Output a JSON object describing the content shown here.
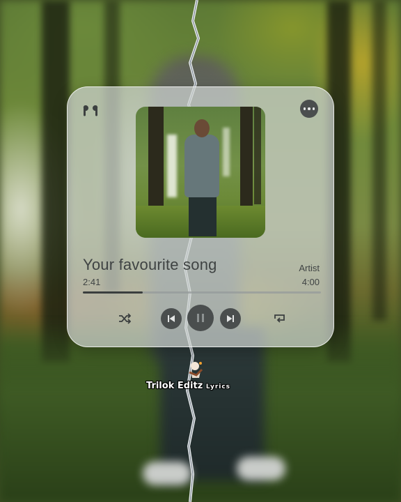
{
  "player": {
    "song_title": "Your favourite song",
    "artist": "Artist",
    "current_time": "2:41",
    "total_time": "4:00",
    "progress": 0.25
  },
  "icons": {
    "top_left": "earbuds-icon",
    "top_right": "more-options-icon",
    "controls": [
      "shuffle-icon",
      "previous-icon",
      "pause-icon",
      "next-icon",
      "repeat-icon"
    ]
  },
  "watermark": {
    "text": "Trilok Editz",
    "suffix": "Lyrics"
  },
  "colors": {
    "card": "#cdd2d0",
    "control_bg": "#4a4e4e",
    "text": "#3f4343"
  }
}
